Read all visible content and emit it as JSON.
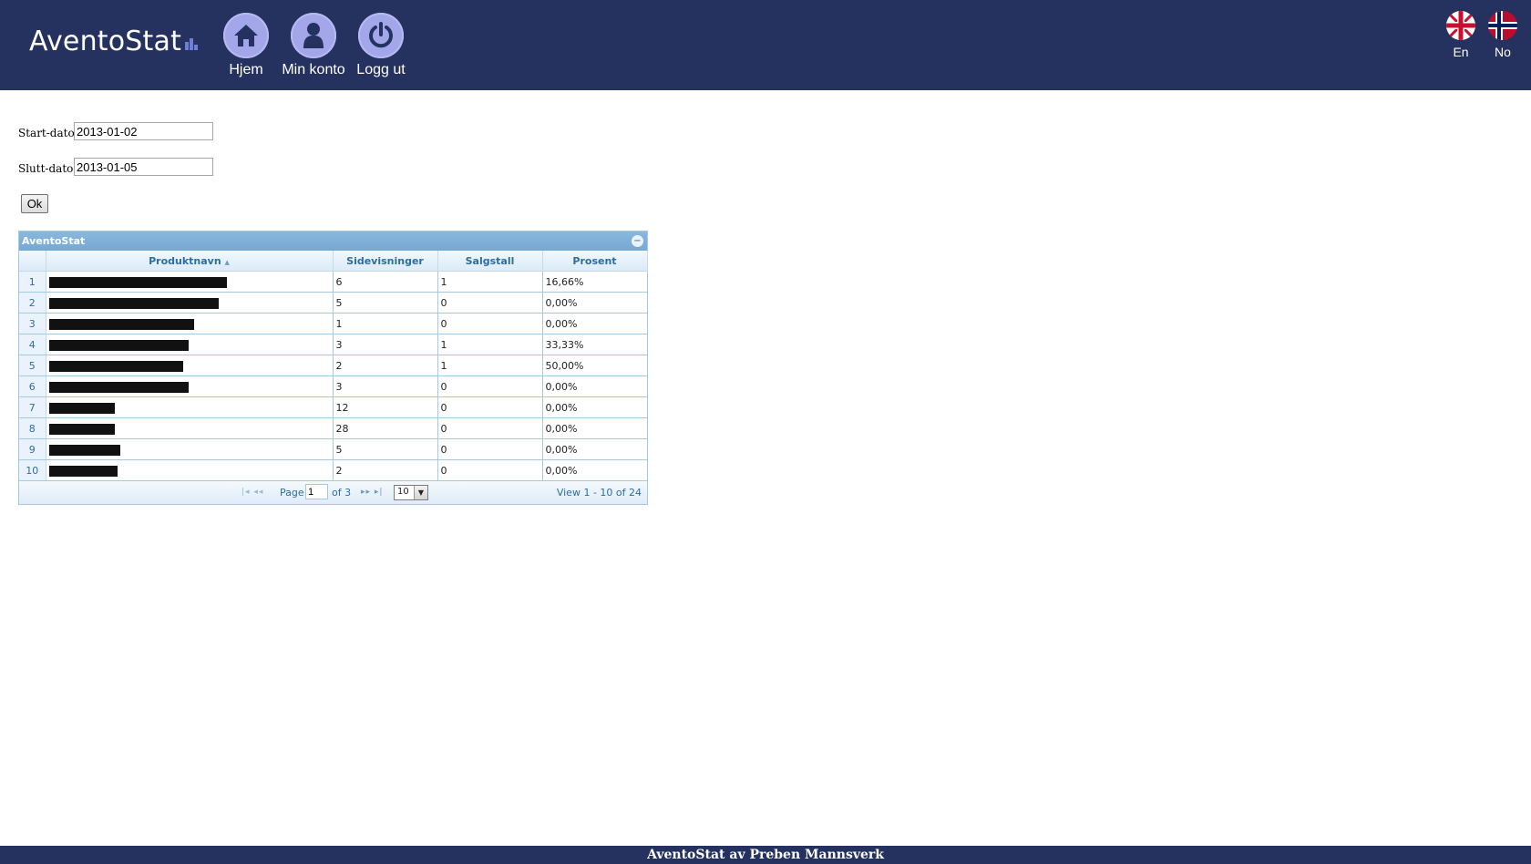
{
  "header": {
    "logo_text": "AventoStat",
    "nav": [
      {
        "label": "Hjem",
        "icon": "home-icon"
      },
      {
        "label": "Min konto",
        "icon": "user-icon"
      },
      {
        "label": "Logg ut",
        "icon": "power-icon"
      }
    ],
    "languages": [
      {
        "label": "En",
        "icon": "uk-flag-icon"
      },
      {
        "label": "No",
        "icon": "norway-flag-icon"
      }
    ]
  },
  "form": {
    "start_label": "Start-dato:",
    "start_value": "2013-01-02",
    "end_label": "Slutt-dato:",
    "end_value": "2013-01-05",
    "ok_label": "Ok"
  },
  "grid": {
    "caption": "AventoStat",
    "columns": [
      "Produktnavn",
      "Sidevisninger",
      "Salgstall",
      "Prosent"
    ],
    "sort_indicator": "▲",
    "rows": [
      {
        "n": "1",
        "views": "6",
        "sales": "1",
        "pct": "16,66%",
        "redact": 0.65
      },
      {
        "n": "2",
        "views": "5",
        "sales": "0",
        "pct": "0,00%",
        "redact": 0.62
      },
      {
        "n": "3",
        "views": "1",
        "sales": "0",
        "pct": "0,00%",
        "redact": 0.53
      },
      {
        "n": "4",
        "views": "3",
        "sales": "1",
        "pct": "33,33%",
        "redact": 0.51
      },
      {
        "n": "5",
        "views": "2",
        "sales": "1",
        "pct": "50,00%",
        "redact": 0.49
      },
      {
        "n": "6",
        "views": "3",
        "sales": "0",
        "pct": "0,00%",
        "redact": 0.51
      },
      {
        "n": "7",
        "views": "12",
        "sales": "0",
        "pct": "0,00%",
        "redact": 0.24
      },
      {
        "n": "8",
        "views": "28",
        "sales": "0",
        "pct": "0,00%",
        "redact": 0.24
      },
      {
        "n": "9",
        "views": "5",
        "sales": "0",
        "pct": "0,00%",
        "redact": 0.26
      },
      {
        "n": "10",
        "views": "2",
        "sales": "0",
        "pct": "0,00%",
        "redact": 0.25
      }
    ],
    "pager": {
      "page_label": "Page",
      "page_value": "1",
      "of_label": "of 3",
      "rows_per_page": "10",
      "view_text": "View 1 - 10 of 24"
    }
  },
  "footer": {
    "text": "AventoStat av Preben Mannsverk"
  },
  "colors": {
    "header_bg": "#253260",
    "nav_circle": "#a3a7ea",
    "grid_border": "#a6c9e2",
    "grid_header_text": "#2e6e9e"
  }
}
